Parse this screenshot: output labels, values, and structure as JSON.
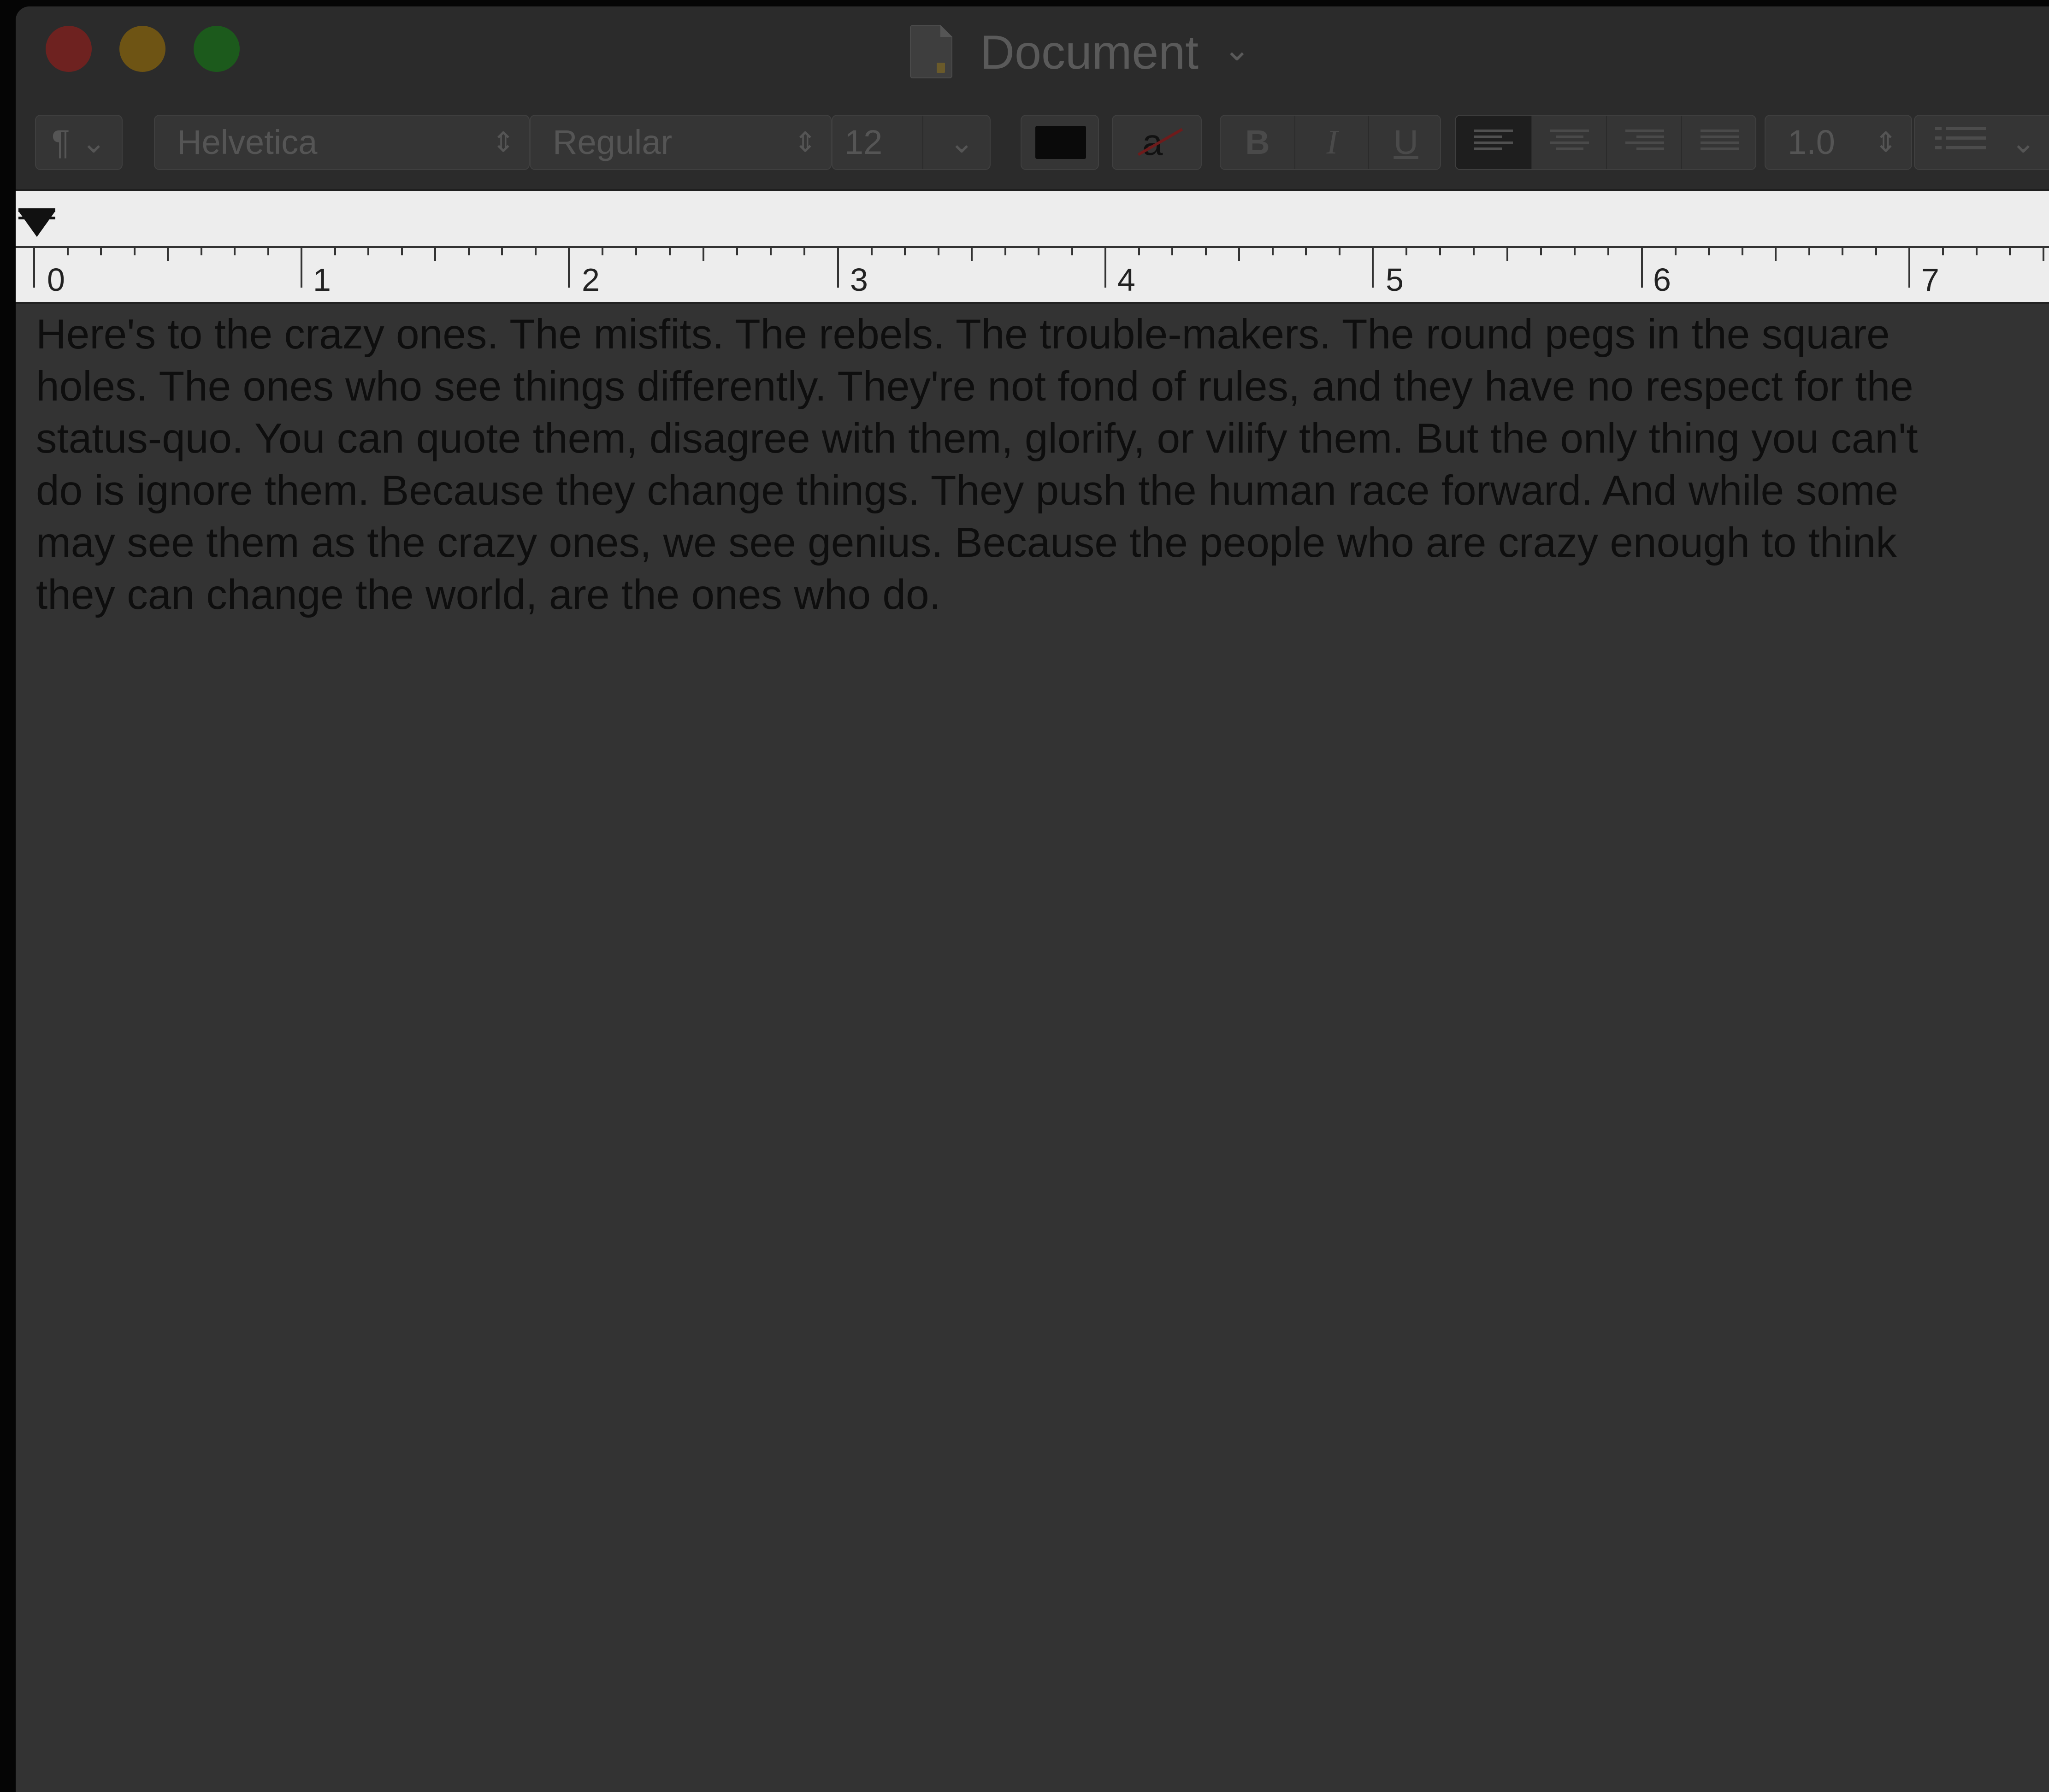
{
  "window": {
    "title": "Document",
    "traffic_lights": {
      "close": "#6e2220",
      "minimize": "#6e5414",
      "zoom": "#1c5a1c"
    }
  },
  "toolbar": {
    "paragraph_style_glyph": "¶",
    "font_family": "Helvetica",
    "font_style": "Regular",
    "font_size": "12",
    "text_color": "#000000",
    "highlight_glyph": "a",
    "bold": "B",
    "italic": "I",
    "underline": "U",
    "alignment_selected": "left",
    "line_spacing": "1.0"
  },
  "ruler": {
    "labels": [
      "0",
      "1",
      "2",
      "3",
      "4",
      "5",
      "6",
      "7"
    ]
  },
  "document": {
    "lines": [
      "Here's to the crazy ones. The misfits. The rebels. The trouble-makers. The round pegs in the square",
      "holes. The ones who see things differently. They're not fond of rules, and they have no respect for the",
      "status-quo. You can quote them, disagree with them, glorify, or vilify them. But the only thing you can't",
      "do is ignore them. Because they change things. They push the human race forward. And while some",
      "may see them as the crazy ones, we see genius. Because the people who are crazy enough to think",
      "they can change the world, are the ones who do."
    ]
  }
}
